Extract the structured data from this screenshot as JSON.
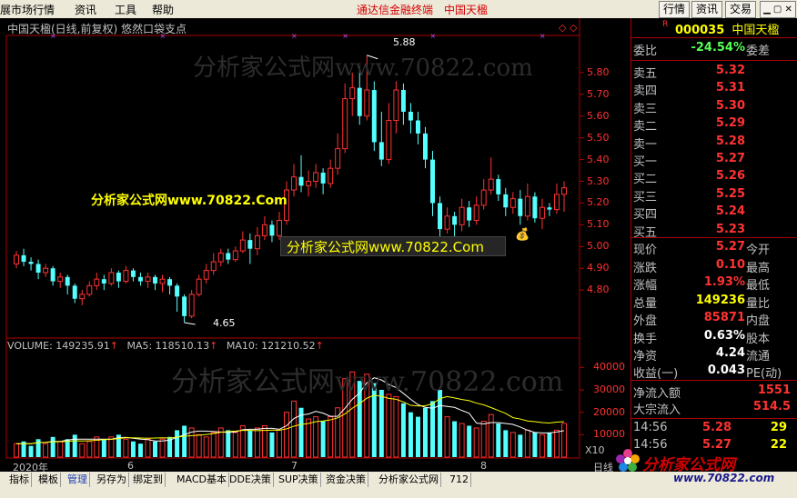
{
  "menu": {
    "items": [
      "展市场行情",
      "资讯",
      "工具",
      "帮助"
    ],
    "center_title": "通达信金融终端",
    "center_stock": "中国天楹",
    "right_buttons": [
      "行情",
      "资讯",
      "交易"
    ],
    "right_icons": "▁ ▢ ✕"
  },
  "chart": {
    "header": "中国天楹(日线,前复权) 悠然口袋支点",
    "high_label": "5.88",
    "low_label": "4.65",
    "watermark_1": "分析家公式网www.70822.com",
    "watermark_2": "分析家公式网www.70822.Com",
    "watermark_3": "分析家公式网www.70822.Com",
    "watermark_4": "分析家公式网www.70822.com",
    "price_ticks": [
      "5.80",
      "5.70",
      "5.60",
      "5.50",
      "5.40",
      "5.30",
      "5.20",
      "5.10",
      "5.00",
      "4.90",
      "4.80"
    ],
    "volume_header": "VOLUME: 149235.91",
    "ma5": "MA5: 118510.13",
    "ma10": "MA10: 121210.52",
    "volume_ticks": [
      "40000",
      "30000",
      "20000",
      "10000"
    ],
    "volume_unit": "X10",
    "x_labels": [
      "2020年",
      "6",
      "7",
      "8"
    ],
    "x_right": "日线",
    "colors": {
      "up": "#ff3232",
      "down": "#54ffff",
      "ma5": "#ffffff",
      "ma10": "#ffff00"
    }
  },
  "chart_data": {
    "type": "candlestick",
    "candles": [
      [
        4.92,
        4.96,
        4.98,
        4.9
      ],
      [
        4.96,
        4.93,
        4.99,
        4.91
      ],
      [
        4.93,
        4.92,
        4.95,
        4.89
      ],
      [
        4.92,
        4.88,
        4.94,
        4.85
      ],
      [
        4.88,
        4.9,
        4.92,
        4.86
      ],
      [
        4.9,
        4.84,
        4.91,
        4.82
      ],
      [
        4.84,
        4.86,
        4.88,
        4.81
      ],
      [
        4.86,
        4.82,
        4.87,
        4.78
      ],
      [
        4.82,
        4.76,
        4.83,
        4.74
      ],
      [
        4.76,
        4.78,
        4.8,
        4.73
      ],
      [
        4.78,
        4.82,
        4.84,
        4.77
      ],
      [
        4.82,
        4.85,
        4.88,
        4.8
      ],
      [
        4.85,
        4.83,
        4.87,
        4.8
      ],
      [
        4.83,
        4.88,
        4.9,
        4.82
      ],
      [
        4.88,
        4.84,
        4.89,
        4.81
      ],
      [
        4.84,
        4.89,
        4.91,
        4.83
      ],
      [
        4.89,
        4.86,
        4.9,
        4.84
      ],
      [
        4.86,
        4.84,
        4.88,
        4.82
      ],
      [
        4.84,
        4.86,
        4.88,
        4.81
      ],
      [
        4.86,
        4.83,
        4.87,
        4.8
      ],
      [
        4.83,
        4.85,
        4.87,
        4.79
      ],
      [
        4.85,
        4.82,
        4.86,
        4.78
      ],
      [
        4.82,
        4.77,
        4.83,
        4.7
      ],
      [
        4.77,
        4.68,
        4.78,
        4.65
      ],
      [
        4.68,
        4.78,
        4.8,
        4.67
      ],
      [
        4.78,
        4.85,
        4.87,
        4.77
      ],
      [
        4.85,
        4.89,
        4.92,
        4.83
      ],
      [
        4.89,
        4.93,
        4.97,
        4.87
      ],
      [
        4.93,
        4.97,
        4.99,
        4.91
      ],
      [
        4.97,
        4.94,
        4.99,
        4.92
      ],
      [
        4.94,
        4.98,
        5.0,
        4.93
      ],
      [
        4.98,
        5.03,
        5.07,
        4.97
      ],
      [
        5.03,
        4.99,
        5.06,
        4.92
      ],
      [
        4.99,
        5.05,
        5.09,
        4.96
      ],
      [
        5.05,
        5.1,
        5.14,
        5.03
      ],
      [
        5.1,
        5.05,
        5.12,
        5.02
      ],
      [
        5.05,
        5.12,
        5.16,
        5.03
      ],
      [
        5.12,
        5.26,
        5.3,
        5.1
      ],
      [
        5.26,
        5.32,
        5.38,
        5.23
      ],
      [
        5.32,
        5.28,
        5.42,
        5.25
      ],
      [
        5.28,
        5.3,
        5.35,
        5.23
      ],
      [
        5.3,
        5.34,
        5.38,
        5.27
      ],
      [
        5.34,
        5.29,
        5.36,
        5.24
      ],
      [
        5.29,
        5.36,
        5.4,
        5.27
      ],
      [
        5.36,
        5.45,
        5.52,
        5.33
      ],
      [
        5.45,
        5.68,
        5.75,
        5.43
      ],
      [
        5.68,
        5.73,
        5.8,
        5.6
      ],
      [
        5.73,
        5.6,
        5.83,
        5.56
      ],
      [
        5.6,
        5.72,
        5.88,
        5.58
      ],
      [
        5.72,
        5.48,
        5.76,
        5.44
      ],
      [
        5.48,
        5.4,
        5.62,
        5.37
      ],
      [
        5.4,
        5.58,
        5.66,
        5.38
      ],
      [
        5.58,
        5.72,
        5.76,
        5.52
      ],
      [
        5.72,
        5.62,
        5.75,
        5.56
      ],
      [
        5.62,
        5.58,
        5.66,
        5.52
      ],
      [
        5.58,
        5.52,
        5.62,
        5.47
      ],
      [
        5.52,
        5.4,
        5.55,
        5.36
      ],
      [
        5.4,
        5.2,
        5.44,
        5.14
      ],
      [
        5.2,
        5.08,
        5.23,
        5.03
      ],
      [
        5.08,
        5.14,
        5.18,
        5.06
      ],
      [
        5.14,
        5.1,
        5.16,
        5.04
      ],
      [
        5.1,
        5.18,
        5.22,
        5.07
      ],
      [
        5.18,
        5.12,
        5.21,
        5.09
      ],
      [
        5.12,
        5.19,
        5.23,
        5.1
      ],
      [
        5.19,
        5.26,
        5.31,
        5.17
      ],
      [
        5.26,
        5.31,
        5.41,
        5.24
      ],
      [
        5.31,
        5.24,
        5.33,
        5.21
      ],
      [
        5.24,
        5.18,
        5.27,
        5.14
      ],
      [
        5.18,
        5.22,
        5.25,
        5.15
      ],
      [
        5.22,
        5.14,
        5.26,
        5.1
      ],
      [
        5.14,
        5.23,
        5.29,
        5.12
      ],
      [
        5.23,
        5.13,
        5.25,
        5.11
      ],
      [
        5.13,
        5.18,
        5.22,
        5.08
      ],
      [
        5.18,
        5.17,
        5.2,
        5.14
      ],
      [
        5.17,
        5.24,
        5.29,
        5.15
      ],
      [
        5.24,
        5.27,
        5.3,
        5.16
      ]
    ],
    "volume": [
      6,
      7,
      5,
      8,
      6,
      9,
      7,
      8,
      10,
      6,
      7,
      9,
      8,
      9,
      10,
      8,
      7,
      6,
      8,
      7,
      8,
      9,
      12,
      14,
      13,
      10,
      9,
      11,
      13,
      12,
      11,
      14,
      12,
      13,
      14,
      11,
      12,
      20,
      25,
      22,
      17,
      18,
      16,
      18,
      22,
      35,
      38,
      34,
      37,
      33,
      30,
      28,
      27,
      24,
      20,
      18,
      22,
      25,
      30,
      18,
      16,
      15,
      14,
      13,
      16,
      19,
      15,
      12,
      11,
      10,
      12,
      11,
      10,
      11,
      12,
      15
    ],
    "ma5_volume": [
      6,
      6,
      6,
      6.5,
      6.6,
      7,
      7,
      7.6,
      8,
      8,
      8,
      8,
      8,
      8,
      8.6,
      8.8,
      8.4,
      8,
      7.8,
      7.2,
      7.2,
      7.6,
      8.8,
      10,
      11.2,
      11.6,
      11.6,
      11.4,
      11.2,
      11,
      11.2,
      12.2,
      12.4,
      12.4,
      12.8,
      12.8,
      12.4,
      14,
      17.2,
      18.8,
      19.2,
      20.4,
      19.6,
      18.2,
      18.2,
      21.8,
      25.8,
      28.6,
      33.2,
      35.4,
      34.4,
      32.4,
      31,
      28.4,
      25.8,
      23.4,
      22.2,
      21.8,
      23,
      22.6,
      22.2,
      20.8,
      19.6,
      15.2,
      14.8,
      15.4,
      15.4,
      15,
      14.6,
      13.4,
      12,
      11,
      10.8,
      10.8,
      11.2,
      11.8
    ],
    "ma10_volume": [
      6,
      6,
      6,
      6.5,
      6.6,
      6.8,
      6.9,
      7,
      7.3,
      7.2,
      7.3,
      7.5,
      7.8,
      7.9,
      8.3,
      8.6,
      8.6,
      8.5,
      8.4,
      8.5,
      8.6,
      8.5,
      8.9,
      9.3,
      9.6,
      9.8,
      10.1,
      10.5,
      11.1,
      11.4,
      11.6,
      11.9,
      11.9,
      11.8,
      11.9,
      12,
      12,
      12.6,
      13.8,
      14.6,
      15,
      15.8,
      16.1,
      16.6,
      17.5,
      19.3,
      21.8,
      23.9,
      26.3,
      27.6,
      27.1,
      26.2,
      25.8,
      24.6,
      23.1,
      22.8,
      22.9,
      23.8,
      26.1,
      27,
      26.4,
      25.7,
      25.2,
      24.1,
      23.3,
      22.1,
      20.8,
      19.5,
      17.6,
      17,
      16.1,
      15.8,
      15.4,
      15.2,
      15.6,
      15.8
    ],
    "ylim": [
      4.6,
      5.95
    ],
    "vol_max": 45
  },
  "side": {
    "code": "000035",
    "name": "中国天楹",
    "weibi_label": "委比",
    "weibi_value": "-24.54%",
    "weicha_label": "委差",
    "asks": [
      [
        "卖五",
        "5.32"
      ],
      [
        "卖四",
        "5.31"
      ],
      [
        "卖三",
        "5.30"
      ],
      [
        "卖二",
        "5.29"
      ],
      [
        "卖一",
        "5.28"
      ]
    ],
    "bids": [
      [
        "买一",
        "5.27"
      ],
      [
        "买二",
        "5.26"
      ],
      [
        "买三",
        "5.25"
      ],
      [
        "买四",
        "5.24"
      ],
      [
        "买五",
        "5.23"
      ]
    ],
    "stats": [
      [
        "现价",
        "5.27",
        "今开"
      ],
      [
        "涨跌",
        "0.10",
        "最高"
      ],
      [
        "涨幅",
        "1.93%",
        "最低"
      ],
      [
        "总量",
        "149236",
        "量比"
      ],
      [
        "外盘",
        "85871",
        "内盘"
      ],
      [
        "换手",
        "0.63%",
        "股本"
      ],
      [
        "净资",
        "4.24",
        "流通"
      ],
      [
        "收益(一)",
        "0.043",
        "PE(动)"
      ]
    ],
    "flows": [
      [
        "净流入额",
        "1551"
      ],
      [
        "大宗流入",
        "514.5"
      ]
    ],
    "ticks": [
      [
        "14:56",
        "5.28",
        "29"
      ],
      [
        "14:56",
        "5.27",
        "22"
      ]
    ]
  },
  "bottom": {
    "tabs": [
      "指标",
      "模板",
      "管理",
      "另存为",
      "绑定到",
      "MACD基本",
      "DDE决策",
      "SUP决策",
      "资金决策",
      "分析家公式网",
      "712"
    ],
    "logo_text": "分析家公式网",
    "logo_url": "www.70822.com"
  }
}
